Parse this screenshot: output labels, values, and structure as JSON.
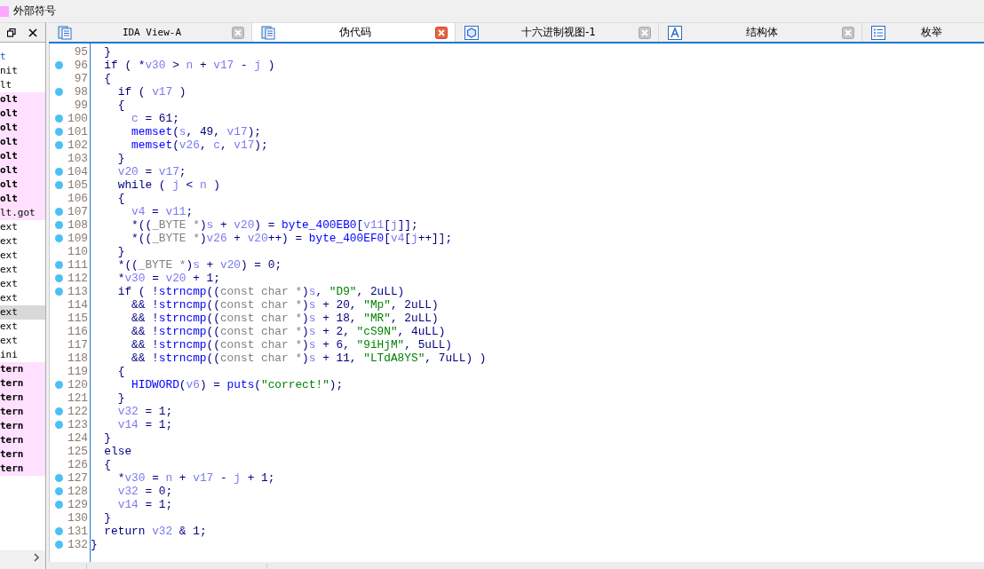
{
  "legend": {
    "label": "外部符号"
  },
  "sidebar": {
    "items": [
      {
        "text": "t",
        "kind": "link",
        "highlighted": false,
        "bold": false,
        "selected": false
      },
      {
        "text": "nit",
        "kind": "plain",
        "highlighted": false,
        "bold": false,
        "selected": false
      },
      {
        "text": "lt",
        "kind": "plain",
        "highlighted": false,
        "bold": false,
        "selected": false
      },
      {
        "text": "olt",
        "kind": "plain",
        "highlighted": true,
        "bold": true,
        "selected": false
      },
      {
        "text": "olt",
        "kind": "plain",
        "highlighted": true,
        "bold": true,
        "selected": false
      },
      {
        "text": "olt",
        "kind": "plain",
        "highlighted": true,
        "bold": true,
        "selected": false
      },
      {
        "text": "olt",
        "kind": "plain",
        "highlighted": true,
        "bold": true,
        "selected": false
      },
      {
        "text": "olt",
        "kind": "plain",
        "highlighted": true,
        "bold": true,
        "selected": false
      },
      {
        "text": "olt",
        "kind": "plain",
        "highlighted": true,
        "bold": true,
        "selected": false
      },
      {
        "text": "olt",
        "kind": "plain",
        "highlighted": true,
        "bold": true,
        "selected": false
      },
      {
        "text": "olt",
        "kind": "plain",
        "highlighted": true,
        "bold": true,
        "selected": false
      },
      {
        "text": "lt.got",
        "kind": "plain",
        "highlighted": true,
        "bold": false,
        "selected": false
      },
      {
        "text": "ext",
        "kind": "plain",
        "highlighted": false,
        "bold": false,
        "selected": false
      },
      {
        "text": "ext",
        "kind": "plain",
        "highlighted": false,
        "bold": false,
        "selected": false
      },
      {
        "text": "ext",
        "kind": "plain",
        "highlighted": false,
        "bold": false,
        "selected": false
      },
      {
        "text": "ext",
        "kind": "plain",
        "highlighted": false,
        "bold": false,
        "selected": false
      },
      {
        "text": "ext",
        "kind": "plain",
        "highlighted": false,
        "bold": false,
        "selected": false
      },
      {
        "text": "ext",
        "kind": "plain",
        "highlighted": false,
        "bold": false,
        "selected": false
      },
      {
        "text": "ext",
        "kind": "plain",
        "highlighted": false,
        "bold": false,
        "selected": true
      },
      {
        "text": "ext",
        "kind": "plain",
        "highlighted": false,
        "bold": false,
        "selected": false
      },
      {
        "text": "ext",
        "kind": "plain",
        "highlighted": false,
        "bold": false,
        "selected": false
      },
      {
        "text": "ini",
        "kind": "plain",
        "highlighted": false,
        "bold": false,
        "selected": false
      },
      {
        "text": "tern",
        "kind": "plain",
        "highlighted": true,
        "bold": true,
        "selected": false
      },
      {
        "text": "tern",
        "kind": "plain",
        "highlighted": true,
        "bold": true,
        "selected": false
      },
      {
        "text": "tern",
        "kind": "plain",
        "highlighted": true,
        "bold": true,
        "selected": false
      },
      {
        "text": "tern",
        "kind": "plain",
        "highlighted": true,
        "bold": true,
        "selected": false
      },
      {
        "text": "tern",
        "kind": "plain",
        "highlighted": true,
        "bold": true,
        "selected": false
      },
      {
        "text": "tern",
        "kind": "plain",
        "highlighted": true,
        "bold": true,
        "selected": false
      },
      {
        "text": "tern",
        "kind": "plain",
        "highlighted": true,
        "bold": true,
        "selected": false
      },
      {
        "text": "tern",
        "kind": "plain",
        "highlighted": true,
        "bold": true,
        "selected": false
      }
    ]
  },
  "tabs": [
    {
      "label": "IDA View-A",
      "kind": "listing",
      "selected": false
    },
    {
      "label": "伪代码",
      "kind": "listing",
      "selected": true
    },
    {
      "label": "十六进制视图-1",
      "kind": "hex",
      "selected": false
    },
    {
      "label": "结构体",
      "kind": "struct",
      "selected": false
    },
    {
      "label": "枚举",
      "kind": "enum",
      "selected": false
    }
  ],
  "lines": [
    {
      "number": "95",
      "marker": false,
      "tokens": [
        {
          "kind": "code",
          "text": "  }"
        }
      ]
    },
    {
      "number": "96",
      "marker": true,
      "tokens": [
        {
          "kind": "code",
          "text": "  if ( *"
        },
        {
          "kind": "var",
          "text": "v30"
        },
        {
          "kind": "code",
          "text": " > "
        },
        {
          "kind": "var",
          "text": "n"
        },
        {
          "kind": "code",
          "text": " + "
        },
        {
          "kind": "var",
          "text": "v17"
        },
        {
          "kind": "code",
          "text": " - "
        },
        {
          "kind": "var",
          "text": "j"
        },
        {
          "kind": "code",
          "text": " )"
        }
      ]
    },
    {
      "number": "97",
      "marker": false,
      "tokens": [
        {
          "kind": "code",
          "text": "  {"
        }
      ]
    },
    {
      "number": "98",
      "marker": true,
      "tokens": [
        {
          "kind": "code",
          "text": "    if ( "
        },
        {
          "kind": "var",
          "text": "v17"
        },
        {
          "kind": "code",
          "text": " )"
        }
      ]
    },
    {
      "number": "99",
      "marker": false,
      "tokens": [
        {
          "kind": "code",
          "text": "    {"
        }
      ]
    },
    {
      "number": "100",
      "marker": true,
      "tokens": [
        {
          "kind": "var",
          "text": "      c"
        },
        {
          "kind": "code",
          "text": " = 61;"
        }
      ]
    },
    {
      "number": "101",
      "marker": true,
      "tokens": [
        {
          "kind": "func",
          "text": "      memset"
        },
        {
          "kind": "code",
          "text": "("
        },
        {
          "kind": "var",
          "text": "s"
        },
        {
          "kind": "code",
          "text": ", 49, "
        },
        {
          "kind": "var",
          "text": "v17"
        },
        {
          "kind": "code",
          "text": ");"
        }
      ]
    },
    {
      "number": "102",
      "marker": true,
      "tokens": [
        {
          "kind": "func",
          "text": "      memset"
        },
        {
          "kind": "code",
          "text": "("
        },
        {
          "kind": "var",
          "text": "v26"
        },
        {
          "kind": "code",
          "text": ", "
        },
        {
          "kind": "var",
          "text": "c"
        },
        {
          "kind": "code",
          "text": ", "
        },
        {
          "kind": "var",
          "text": "v17"
        },
        {
          "kind": "code",
          "text": ");"
        }
      ]
    },
    {
      "number": "103",
      "marker": false,
      "tokens": [
        {
          "kind": "code",
          "text": "    }"
        }
      ]
    },
    {
      "number": "104",
      "marker": true,
      "tokens": [
        {
          "kind": "var",
          "text": "    v20"
        },
        {
          "kind": "code",
          "text": " = "
        },
        {
          "kind": "var",
          "text": "v17"
        },
        {
          "kind": "code",
          "text": ";"
        }
      ]
    },
    {
      "number": "105",
      "marker": true,
      "tokens": [
        {
          "kind": "code",
          "text": "    while ( "
        },
        {
          "kind": "var",
          "text": "j"
        },
        {
          "kind": "code",
          "text": " < "
        },
        {
          "kind": "var",
          "text": "n"
        },
        {
          "kind": "code",
          "text": " )"
        }
      ]
    },
    {
      "number": "106",
      "marker": false,
      "tokens": [
        {
          "kind": "code",
          "text": "    {"
        }
      ]
    },
    {
      "number": "107",
      "marker": true,
      "tokens": [
        {
          "kind": "var",
          "text": "      v4"
        },
        {
          "kind": "code",
          "text": " = "
        },
        {
          "kind": "var",
          "text": "v11"
        },
        {
          "kind": "code",
          "text": ";"
        }
      ]
    },
    {
      "number": "108",
      "marker": true,
      "tokens": [
        {
          "kind": "code",
          "text": "      *(("
        },
        {
          "kind": "cast",
          "text": "_BYTE *"
        },
        {
          "kind": "code",
          "text": ")"
        },
        {
          "kind": "var",
          "text": "s"
        },
        {
          "kind": "code",
          "text": " + "
        },
        {
          "kind": "var",
          "text": "v20"
        },
        {
          "kind": "code",
          "text": ") = "
        },
        {
          "kind": "func",
          "text": "byte_400EB0"
        },
        {
          "kind": "code",
          "text": "["
        },
        {
          "kind": "var",
          "text": "v11"
        },
        {
          "kind": "code",
          "text": "["
        },
        {
          "kind": "var",
          "text": "j"
        },
        {
          "kind": "code",
          "text": "]];"
        }
      ]
    },
    {
      "number": "109",
      "marker": true,
      "tokens": [
        {
          "kind": "code",
          "text": "      *(("
        },
        {
          "kind": "cast",
          "text": "_BYTE *"
        },
        {
          "kind": "code",
          "text": ")"
        },
        {
          "kind": "var",
          "text": "v26"
        },
        {
          "kind": "code",
          "text": " + "
        },
        {
          "kind": "var",
          "text": "v20"
        },
        {
          "kind": "code",
          "text": "++) = "
        },
        {
          "kind": "func",
          "text": "byte_400EF0"
        },
        {
          "kind": "code",
          "text": "["
        },
        {
          "kind": "var",
          "text": "v4"
        },
        {
          "kind": "code",
          "text": "["
        },
        {
          "kind": "var",
          "text": "j"
        },
        {
          "kind": "code",
          "text": "++]];"
        }
      ]
    },
    {
      "number": "110",
      "marker": false,
      "tokens": [
        {
          "kind": "code",
          "text": "    }"
        }
      ]
    },
    {
      "number": "111",
      "marker": true,
      "tokens": [
        {
          "kind": "code",
          "text": "    *(("
        },
        {
          "kind": "cast",
          "text": "_BYTE *"
        },
        {
          "kind": "code",
          "text": ")"
        },
        {
          "kind": "var",
          "text": "s"
        },
        {
          "kind": "code",
          "text": " + "
        },
        {
          "kind": "var",
          "text": "v20"
        },
        {
          "kind": "code",
          "text": ") = 0;"
        }
      ]
    },
    {
      "number": "112",
      "marker": true,
      "tokens": [
        {
          "kind": "code",
          "text": "    *"
        },
        {
          "kind": "var",
          "text": "v30"
        },
        {
          "kind": "code",
          "text": " = "
        },
        {
          "kind": "var",
          "text": "v20"
        },
        {
          "kind": "code",
          "text": " + 1;"
        }
      ]
    },
    {
      "number": "113",
      "marker": true,
      "tokens": [
        {
          "kind": "code",
          "text": "    if ( !"
        },
        {
          "kind": "func",
          "text": "strncmp"
        },
        {
          "kind": "code",
          "text": "(("
        },
        {
          "kind": "cast",
          "text": "const char *"
        },
        {
          "kind": "code",
          "text": ")"
        },
        {
          "kind": "var",
          "text": "s"
        },
        {
          "kind": "code",
          "text": ", "
        },
        {
          "kind": "str",
          "text": "\"D9\""
        },
        {
          "kind": "code",
          "text": ", 2uLL)"
        }
      ]
    },
    {
      "number": "114",
      "marker": false,
      "tokens": [
        {
          "kind": "code",
          "text": "      && !"
        },
        {
          "kind": "func",
          "text": "strncmp"
        },
        {
          "kind": "code",
          "text": "(("
        },
        {
          "kind": "cast",
          "text": "const char *"
        },
        {
          "kind": "code",
          "text": ")"
        },
        {
          "kind": "var",
          "text": "s"
        },
        {
          "kind": "code",
          "text": " + 20, "
        },
        {
          "kind": "str",
          "text": "\"Mp\""
        },
        {
          "kind": "code",
          "text": ", 2uLL)"
        }
      ]
    },
    {
      "number": "115",
      "marker": false,
      "tokens": [
        {
          "kind": "code",
          "text": "      && !"
        },
        {
          "kind": "func",
          "text": "strncmp"
        },
        {
          "kind": "code",
          "text": "(("
        },
        {
          "kind": "cast",
          "text": "const char *"
        },
        {
          "kind": "code",
          "text": ")"
        },
        {
          "kind": "var",
          "text": "s"
        },
        {
          "kind": "code",
          "text": " + 18, "
        },
        {
          "kind": "str",
          "text": "\"MR\""
        },
        {
          "kind": "code",
          "text": ", 2uLL)"
        }
      ]
    },
    {
      "number": "116",
      "marker": false,
      "tokens": [
        {
          "kind": "code",
          "text": "      && !"
        },
        {
          "kind": "func",
          "text": "strncmp"
        },
        {
          "kind": "code",
          "text": "(("
        },
        {
          "kind": "cast",
          "text": "const char *"
        },
        {
          "kind": "code",
          "text": ")"
        },
        {
          "kind": "var",
          "text": "s"
        },
        {
          "kind": "code",
          "text": " + 2, "
        },
        {
          "kind": "str",
          "text": "\"cS9N\""
        },
        {
          "kind": "code",
          "text": ", 4uLL)"
        }
      ]
    },
    {
      "number": "117",
      "marker": false,
      "tokens": [
        {
          "kind": "code",
          "text": "      && !"
        },
        {
          "kind": "func",
          "text": "strncmp"
        },
        {
          "kind": "code",
          "text": "(("
        },
        {
          "kind": "cast",
          "text": "const char *"
        },
        {
          "kind": "code",
          "text": ")"
        },
        {
          "kind": "var",
          "text": "s"
        },
        {
          "kind": "code",
          "text": " + 6, "
        },
        {
          "kind": "str",
          "text": "\"9iHjM\""
        },
        {
          "kind": "code",
          "text": ", 5uLL)"
        }
      ]
    },
    {
      "number": "118",
      "marker": false,
      "tokens": [
        {
          "kind": "code",
          "text": "      && !"
        },
        {
          "kind": "func",
          "text": "strncmp"
        },
        {
          "kind": "code",
          "text": "(("
        },
        {
          "kind": "cast",
          "text": "const char *"
        },
        {
          "kind": "code",
          "text": ")"
        },
        {
          "kind": "var",
          "text": "s"
        },
        {
          "kind": "code",
          "text": " + 11, "
        },
        {
          "kind": "str",
          "text": "\"LTdA8YS\""
        },
        {
          "kind": "code",
          "text": ", 7uLL) )"
        }
      ]
    },
    {
      "number": "119",
      "marker": false,
      "tokens": [
        {
          "kind": "code",
          "text": "    {"
        }
      ]
    },
    {
      "number": "120",
      "marker": true,
      "tokens": [
        {
          "kind": "func",
          "text": "      HIDWORD"
        },
        {
          "kind": "code",
          "text": "("
        },
        {
          "kind": "var",
          "text": "v6"
        },
        {
          "kind": "code",
          "text": ") = "
        },
        {
          "kind": "func",
          "text": "puts"
        },
        {
          "kind": "code",
          "text": "("
        },
        {
          "kind": "str",
          "text": "\"correct!\""
        },
        {
          "kind": "code",
          "text": ");"
        }
      ]
    },
    {
      "number": "121",
      "marker": false,
      "tokens": [
        {
          "kind": "code",
          "text": "    }"
        }
      ]
    },
    {
      "number": "122",
      "marker": true,
      "tokens": [
        {
          "kind": "var",
          "text": "    v32"
        },
        {
          "kind": "code",
          "text": " = 1;"
        }
      ]
    },
    {
      "number": "123",
      "marker": true,
      "tokens": [
        {
          "kind": "var",
          "text": "    v14"
        },
        {
          "kind": "code",
          "text": " = 1;"
        }
      ]
    },
    {
      "number": "124",
      "marker": false,
      "tokens": [
        {
          "kind": "code",
          "text": "  }"
        }
      ]
    },
    {
      "number": "125",
      "marker": false,
      "tokens": [
        {
          "kind": "code",
          "text": "  else"
        }
      ]
    },
    {
      "number": "126",
      "marker": false,
      "tokens": [
        {
          "kind": "code",
          "text": "  {"
        }
      ]
    },
    {
      "number": "127",
      "marker": true,
      "tokens": [
        {
          "kind": "code",
          "text": "    *"
        },
        {
          "kind": "var",
          "text": "v30"
        },
        {
          "kind": "code",
          "text": " = "
        },
        {
          "kind": "var",
          "text": "n"
        },
        {
          "kind": "code",
          "text": " + "
        },
        {
          "kind": "var",
          "text": "v17"
        },
        {
          "kind": "code",
          "text": " - "
        },
        {
          "kind": "var",
          "text": "j"
        },
        {
          "kind": "code",
          "text": " + 1;"
        }
      ]
    },
    {
      "number": "128",
      "marker": true,
      "tokens": [
        {
          "kind": "var",
          "text": "    v32"
        },
        {
          "kind": "code",
          "text": " = 0;"
        }
      ]
    },
    {
      "number": "129",
      "marker": true,
      "tokens": [
        {
          "kind": "var",
          "text": "    v14"
        },
        {
          "kind": "code",
          "text": " = 1;"
        }
      ]
    },
    {
      "number": "130",
      "marker": false,
      "tokens": [
        {
          "kind": "code",
          "text": "  }"
        }
      ]
    },
    {
      "number": "131",
      "marker": true,
      "tokens": [
        {
          "kind": "code",
          "text": "  return "
        },
        {
          "kind": "var",
          "text": "v32"
        },
        {
          "kind": "code",
          "text": " & 1;"
        }
      ]
    },
    {
      "number": "132",
      "marker": true,
      "tokens": [
        {
          "kind": "code",
          "text": "}"
        }
      ]
    }
  ]
}
